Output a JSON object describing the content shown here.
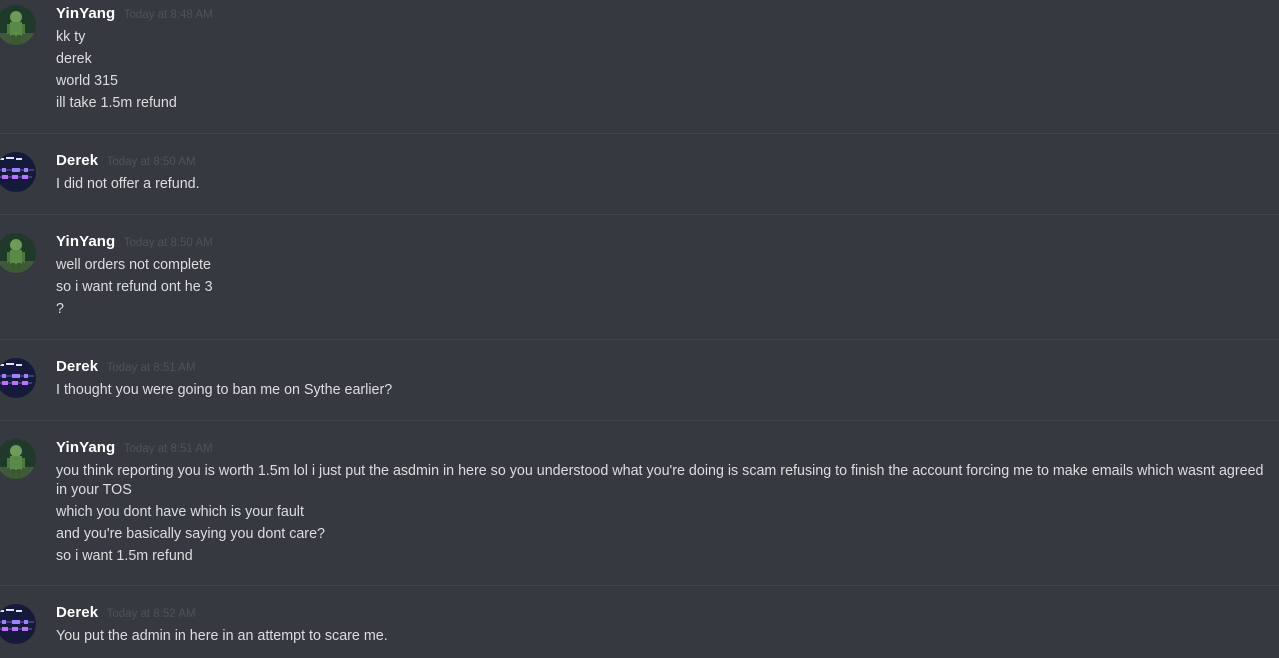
{
  "colors": {
    "background": "#36393f",
    "separator": "#42454a",
    "username": "#ffffff",
    "timestamp": "#4f5258",
    "message_text": "#dcddde"
  },
  "messages": [
    {
      "author": "YinYang",
      "avatar_icon": "green-character-avatar-icon",
      "timestamp": "Today at 8:48 AM",
      "lines": [
        "kk ty",
        "derek",
        "world 315",
        "ill take 1.5m refund"
      ]
    },
    {
      "author": "Derek",
      "avatar_icon": "pixel-art-avatar-icon",
      "timestamp": "Today at 8:50 AM",
      "lines": [
        "I did not offer a refund."
      ]
    },
    {
      "author": "YinYang",
      "avatar_icon": "green-character-avatar-icon",
      "timestamp": "Today at 8:50 AM",
      "lines": [
        "well orders not complete",
        "so i want refund ont he 3",
        "?"
      ]
    },
    {
      "author": "Derek",
      "avatar_icon": "pixel-art-avatar-icon",
      "timestamp": "Today at 8:51 AM",
      "lines": [
        "I thought you were going to ban me on Sythe earlier?"
      ]
    },
    {
      "author": "YinYang",
      "avatar_icon": "green-character-avatar-icon",
      "timestamp": "Today at 8:51 AM",
      "lines": [
        "you think reporting you is worth 1.5m lol i just put the asdmin in here so you understood what you're doing is scam refusing to finish the account forcing me to make emails which wasnt agreed in your TOS",
        "which you dont have which is your fault",
        "and you're basically saying you dont care?",
        "so i want 1.5m refund"
      ]
    },
    {
      "author": "Derek",
      "avatar_icon": "pixel-art-avatar-icon",
      "timestamp": "Today at 8:52 AM",
      "lines": [
        "You put the admin in here in an attempt to scare me."
      ]
    }
  ]
}
